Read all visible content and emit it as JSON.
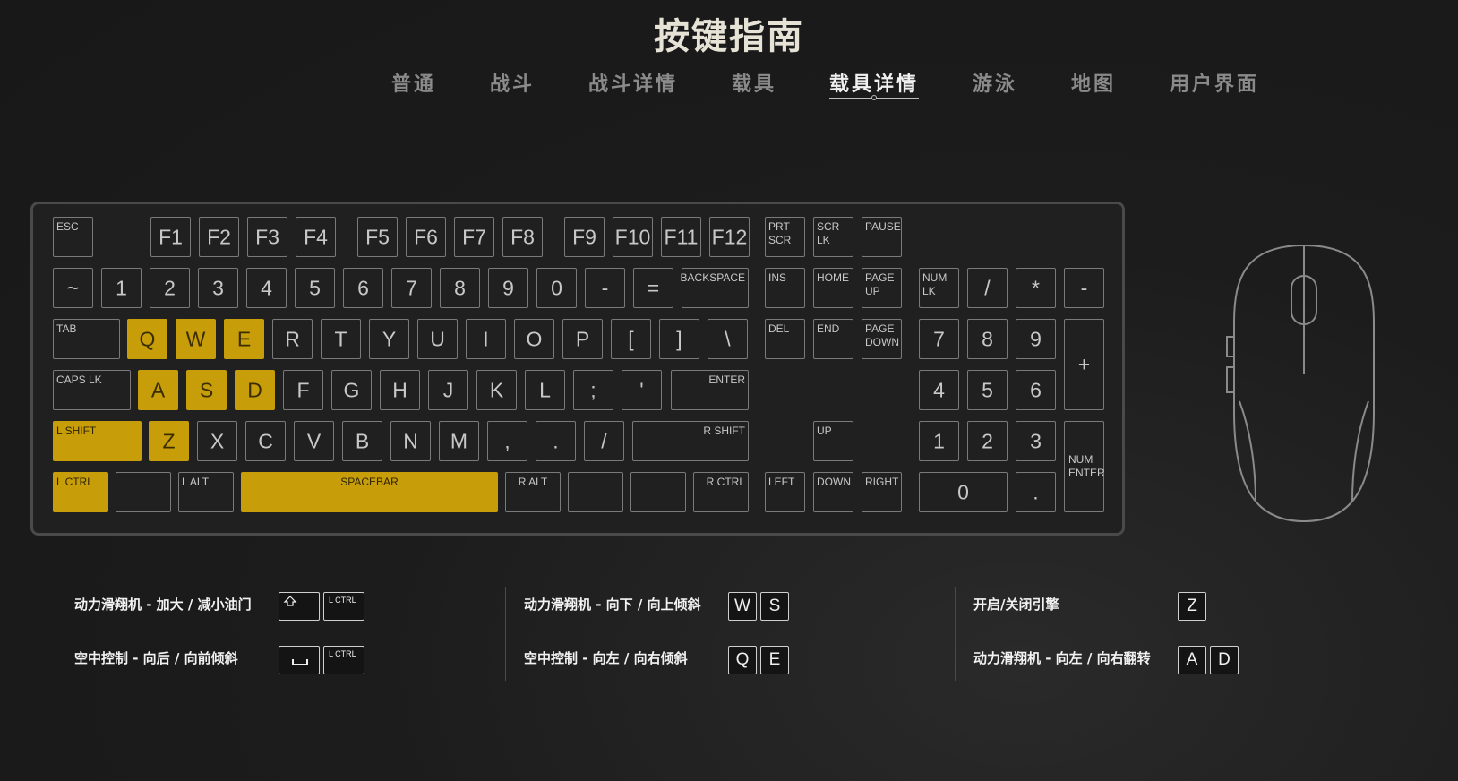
{
  "title": "按键指南",
  "tabs": [
    "普通",
    "战斗",
    "战斗详情",
    "载具",
    "载具详情",
    "游泳",
    "地图",
    "用户界面"
  ],
  "active_tab": "载具详情",
  "highlight_color": "#c79d0a",
  "keys": {
    "esc": "ESC",
    "f1": "F1",
    "f2": "F2",
    "f3": "F3",
    "f4": "F4",
    "f5": "F5",
    "f6": "F6",
    "f7": "F7",
    "f8": "F8",
    "f9": "F9",
    "f10": "F10",
    "f11": "F11",
    "f12": "F12",
    "prtscr": "PRT\nSCR",
    "scrlk": "SCR\nLK",
    "pause": "PAUSE",
    "tilde": "~",
    "n1": "1",
    "n2": "2",
    "n3": "3",
    "n4": "4",
    "n5": "5",
    "n6": "6",
    "n7": "7",
    "n8": "8",
    "n9": "9",
    "n0": "0",
    "minus": "-",
    "equal": "=",
    "backspace": "BACKSPACE",
    "ins": "INS",
    "home": "HOME",
    "pageup": "PAGE\nUP",
    "numlk": "NUM\nLK",
    "npdiv": "/",
    "npmul": "*",
    "npsub": "-",
    "tab": "TAB",
    "q": "Q",
    "w": "W",
    "e": "E",
    "r": "R",
    "t": "T",
    "y": "Y",
    "u": "U",
    "i": "I",
    "o": "O",
    "p": "P",
    "lbracket": "[",
    "rbracket": "]",
    "backslash": "\\",
    "del": "DEL",
    "end": "END",
    "pagedown": "PAGE\nDOWN",
    "np7": "7",
    "np8": "8",
    "np9": "9",
    "npadd": "+",
    "capslk": "CAPS LK",
    "a": "A",
    "s": "S",
    "d": "D",
    "f": "F",
    "g": "G",
    "h": "H",
    "j": "J",
    "k": "K",
    "l": "L",
    "semicolon": ";",
    "quote": "'",
    "enter": "ENTER",
    "np4": "4",
    "np5": "5",
    "np6": "6",
    "lshift": "L SHIFT",
    "z": "Z",
    "x": "X",
    "c": "C",
    "v": "V",
    "b": "B",
    "n": "N",
    "m": "M",
    "comma": ",",
    "period": ".",
    "slash": "/",
    "rshift": "R SHIFT",
    "up": "UP",
    "np1": "1",
    "np2": "2",
    "np3": "3",
    "npenter": "NUM\nENTER",
    "lctrl": "L CTRL",
    "lalt": "L ALT",
    "space": "SPACEBAR",
    "ralt": "R ALT",
    "rctrl": "R CTRL",
    "left": "LEFT",
    "down": "DOWN",
    "right": "RIGHT",
    "np0": "0",
    "npdec": "."
  },
  "highlighted_keys": [
    "q",
    "w",
    "e",
    "a",
    "s",
    "d",
    "z",
    "lshift",
    "lctrl",
    "space"
  ],
  "bindings": [
    {
      "label": "动力滑翔机 - 加大 / 减小油门",
      "keys": [
        "shift-icon",
        "L CTRL"
      ]
    },
    {
      "label": "空中控制 - 向后 / 向前倾斜",
      "keys": [
        "space-icon",
        "L CTRL"
      ]
    },
    {
      "label": "动力滑翔机 - 向下 / 向上倾斜",
      "keys": [
        "W",
        "S"
      ]
    },
    {
      "label": "空中控制 - 向左 / 向右倾斜",
      "keys": [
        "Q",
        "E"
      ]
    },
    {
      "label": "开启/关闭引擎",
      "keys": [
        "Z"
      ]
    },
    {
      "label": "动力滑翔机 - 向左 / 向右翻转",
      "keys": [
        "A",
        "D"
      ]
    }
  ]
}
